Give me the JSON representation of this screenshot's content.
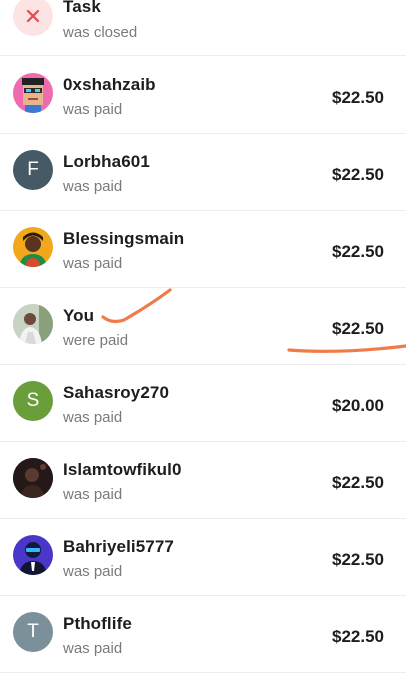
{
  "rows": [
    {
      "name": "Task",
      "status": "was closed",
      "amount": "",
      "avatar": {
        "type": "icon",
        "icon": "close-icon",
        "bg": "#fde4e4",
        "color": "#e24a4a"
      }
    },
    {
      "name": "0xshahzaib",
      "status": "was paid",
      "amount": "$22.50",
      "avatar": {
        "type": "image",
        "icon": "pixel-art-avatar",
        "bg": "#f06ab0"
      }
    },
    {
      "name": "Lorbha601",
      "status": "was paid",
      "amount": "$22.50",
      "avatar": {
        "type": "letter",
        "letter": "F",
        "bg": "#455a64"
      }
    },
    {
      "name": "Blessingsmain",
      "status": "was paid",
      "amount": "$22.50",
      "avatar": {
        "type": "image",
        "icon": "person-avatar",
        "bg": "#f2a81d"
      }
    },
    {
      "name": "You",
      "status": "were paid",
      "amount": "$22.50",
      "avatar": {
        "type": "image",
        "icon": "photo-avatar",
        "bg": "#cfd6cc"
      }
    },
    {
      "name": "Sahasroy270",
      "status": "was paid",
      "amount": "$20.00",
      "avatar": {
        "type": "letter",
        "letter": "S",
        "bg": "#6a9e3a"
      }
    },
    {
      "name": "Islamtowfikul0",
      "status": "was paid",
      "amount": "$22.50",
      "avatar": {
        "type": "image",
        "icon": "dark-photo-avatar",
        "bg": "#2b1d1d"
      }
    },
    {
      "name": "Bahriyeli5777",
      "status": "was paid",
      "amount": "$22.50",
      "avatar": {
        "type": "image",
        "icon": "masked-man-avatar",
        "bg": "#4a36c8"
      }
    },
    {
      "name": "Pthoflife",
      "status": "was paid",
      "amount": "$22.50",
      "avatar": {
        "type": "letter",
        "letter": "T",
        "bg": "#7b909b"
      }
    }
  ],
  "annotation_color": "#f07a4a"
}
